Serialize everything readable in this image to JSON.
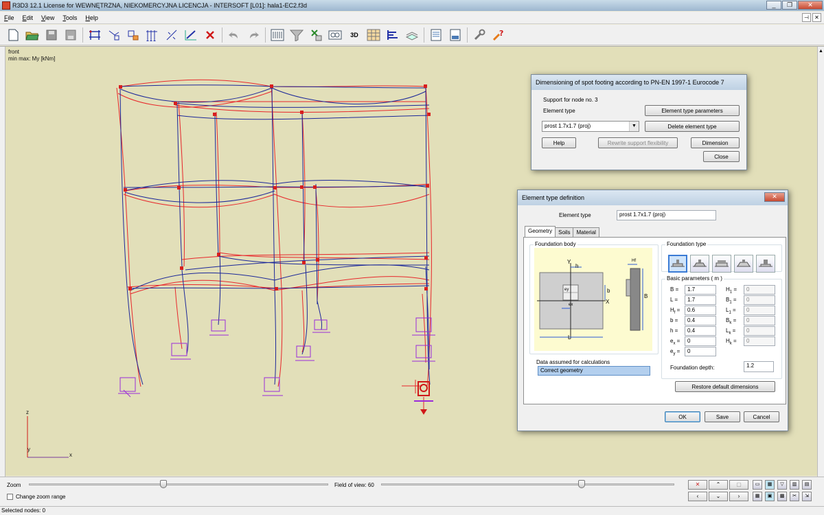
{
  "window": {
    "title": "R3D3 12.1 License for WEWNĘTRZNA, NIEKOMERCYJNA LICENCJA - INTERSOFT [L01]: hala1-EC2.f3d",
    "minimize": "_",
    "restore": "❐",
    "close": "✕"
  },
  "menu": {
    "items": [
      "File",
      "Edit",
      "View",
      "Tools",
      "Help"
    ]
  },
  "toolbar": {
    "icons": [
      "new-icon",
      "open-icon",
      "save-icon",
      "save-as-icon",
      "frame-icon",
      "nodes-icon",
      "elements-icon",
      "supports-icon",
      "loads-icon",
      "edit-icon",
      "delete-icon",
      "undo-icon",
      "redo-icon",
      "calc-icon",
      "filter-icon",
      "structure-icon",
      "view-icon",
      "3d-icon",
      "grid-icon",
      "results-icon",
      "table-icon",
      "report-icon",
      "settings-icon",
      "help-icon"
    ]
  },
  "viewport": {
    "view_name": "front",
    "result_label": "min max: My [kNm]",
    "axis_z": "z",
    "axis_y": "y",
    "axis_x": "x"
  },
  "footing_dialog": {
    "title": "Dimensioning of spot footing according to PN-EN 1997-1 Eurocode 7",
    "support_label": "Support for node no. 3",
    "element_type_label": "Element type",
    "element_type_value": "prost 1.7x1.7 (proj)",
    "btn_element_type_params": "Element type parameters",
    "btn_delete_element_type": "Delete element type",
    "btn_help": "Help",
    "btn_rewrite": "Rewrite support flexibility",
    "btn_dimension": "Dimension",
    "btn_close": "Close"
  },
  "etype_dialog": {
    "title": "Element type definition",
    "element_type_label": "Element type",
    "element_type_value": "prost 1.7x1.7 (proj)",
    "tabs": [
      "Geometry",
      "Soils",
      "Material"
    ],
    "foundation_body_label": "Foundation body",
    "foundation_type_label": "Foundation type",
    "basic_params_label": "Basic parameters  ( m )",
    "params_left": [
      {
        "name": "B",
        "sub": "",
        "value": "1.7"
      },
      {
        "name": "L",
        "sub": "",
        "value": "1.7"
      },
      {
        "name": "H",
        "sub": "f",
        "value": "0.6"
      },
      {
        "name": "b",
        "sub": "",
        "value": "0.4"
      },
      {
        "name": "h",
        "sub": "",
        "value": "0.4"
      },
      {
        "name": "e",
        "sub": "x",
        "value": "0"
      },
      {
        "name": "e",
        "sub": "y",
        "value": "0"
      }
    ],
    "params_right": [
      {
        "name": "H",
        "sub": "1",
        "value": "0"
      },
      {
        "name": "B",
        "sub": "1",
        "value": "0"
      },
      {
        "name": "L",
        "sub": "1",
        "value": "0"
      },
      {
        "name": "B",
        "sub": "k",
        "value": "0"
      },
      {
        "name": "L",
        "sub": "k",
        "value": "0"
      },
      {
        "name": "H",
        "sub": "k",
        "value": "0"
      }
    ],
    "foundation_depth_label": "Foundation depth:",
    "foundation_depth_value": "1.2",
    "data_assumed_label": "Data assumed for calculations",
    "data_assumed_value": "Correct geometry",
    "btn_restore": "Restore default dimensions",
    "btn_ok": "OK",
    "btn_save": "Save",
    "btn_cancel": "Cancel",
    "drawing": {
      "h": "h",
      "b": "b",
      "L": "L",
      "B": "B",
      "Y": "Y",
      "X": "X",
      "ey": "ey",
      "ex": "ex",
      "Hf": "Hf"
    }
  },
  "bottom": {
    "zoom_label": "Zoom",
    "change_zoom_label": "Change zoom range",
    "fov_label": "Field of view: 60"
  },
  "status": {
    "text": "Selected nodes: 0"
  }
}
